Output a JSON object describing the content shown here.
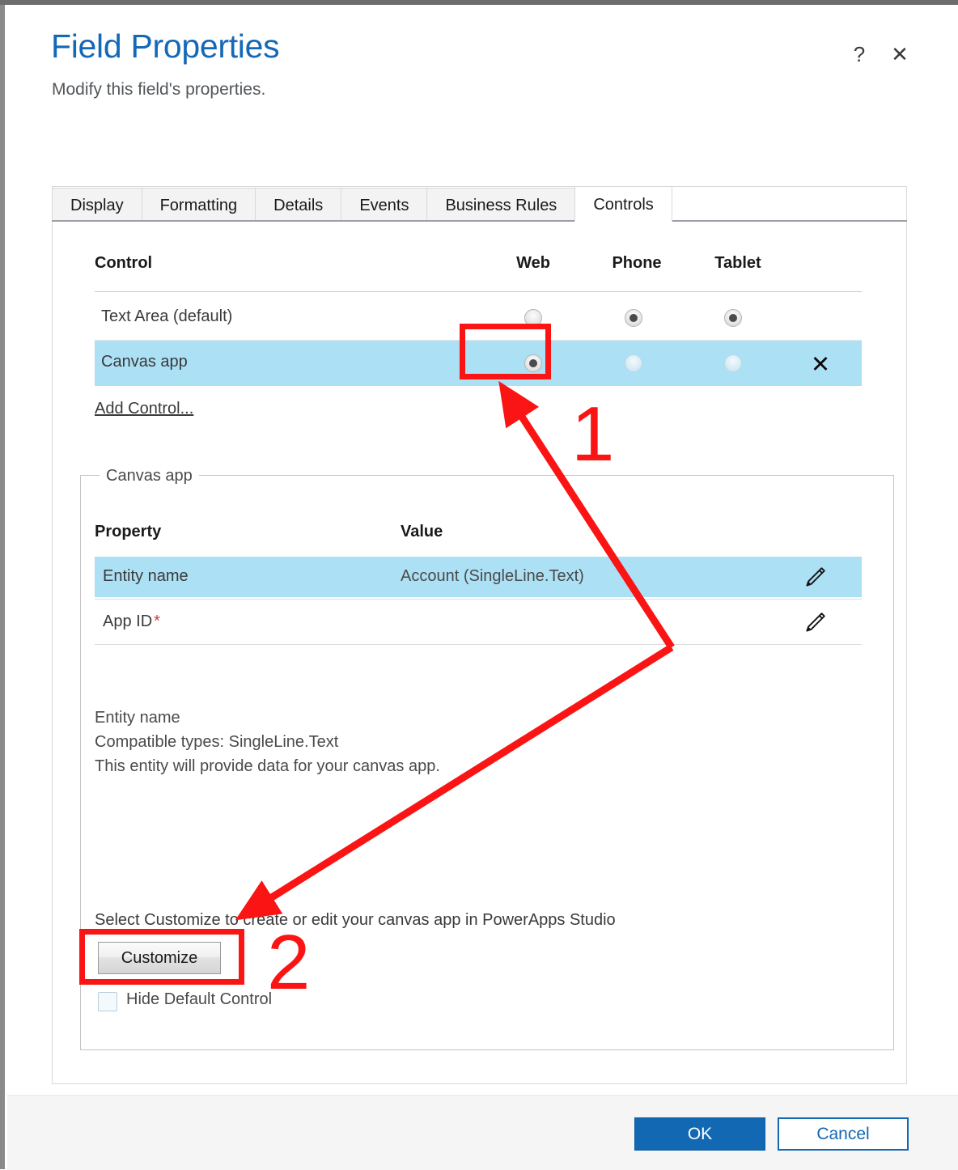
{
  "header": {
    "title": "Field Properties",
    "subtitle": "Modify this field's properties.",
    "help_icon": "help-icon",
    "close_icon": "close-icon"
  },
  "tabs": [
    {
      "label": "Display",
      "active": false
    },
    {
      "label": "Formatting",
      "active": false
    },
    {
      "label": "Details",
      "active": false
    },
    {
      "label": "Events",
      "active": false
    },
    {
      "label": "Business Rules",
      "active": false
    },
    {
      "label": "Controls",
      "active": true
    }
  ],
  "controls_table": {
    "headers": {
      "control": "Control",
      "web": "Web",
      "phone": "Phone",
      "tablet": "Tablet"
    },
    "rows": [
      {
        "name": "Text Area (default)",
        "web_selected": false,
        "phone_selected": true,
        "tablet_selected": true,
        "selected_row": false,
        "deletable": false
      },
      {
        "name": "Canvas app",
        "web_selected": true,
        "phone_selected": false,
        "tablet_selected": false,
        "selected_row": true,
        "deletable": true,
        "delete_icon": "close-icon"
      }
    ],
    "add_control_link": "Add Control..."
  },
  "canvas_app_section": {
    "legend": "Canvas app",
    "property_headers": {
      "property": "Property",
      "value": "Value"
    },
    "properties": [
      {
        "name": "Entity name",
        "value": "Account (SingleLine.Text)",
        "required": false,
        "selected": true,
        "edit_icon": "pencil-icon"
      },
      {
        "name": "App ID",
        "value": "",
        "required": true,
        "required_marker": "*",
        "selected": false,
        "edit_icon": "pencil-icon"
      }
    ],
    "description": {
      "line1": "Entity name",
      "line2": "Compatible types: SingleLine.Text",
      "line3": "This entity will provide data for your canvas app."
    },
    "customize_hint": "Select Customize to create or edit your canvas app in PowerApps Studio",
    "customize_button": "Customize",
    "hide_default_control": {
      "label": "Hide Default Control",
      "checked": false
    }
  },
  "footer": {
    "ok_label": "OK",
    "cancel_label": "Cancel"
  },
  "annotations": {
    "step1": "1",
    "step2": "2",
    "color": "#fb1414"
  }
}
